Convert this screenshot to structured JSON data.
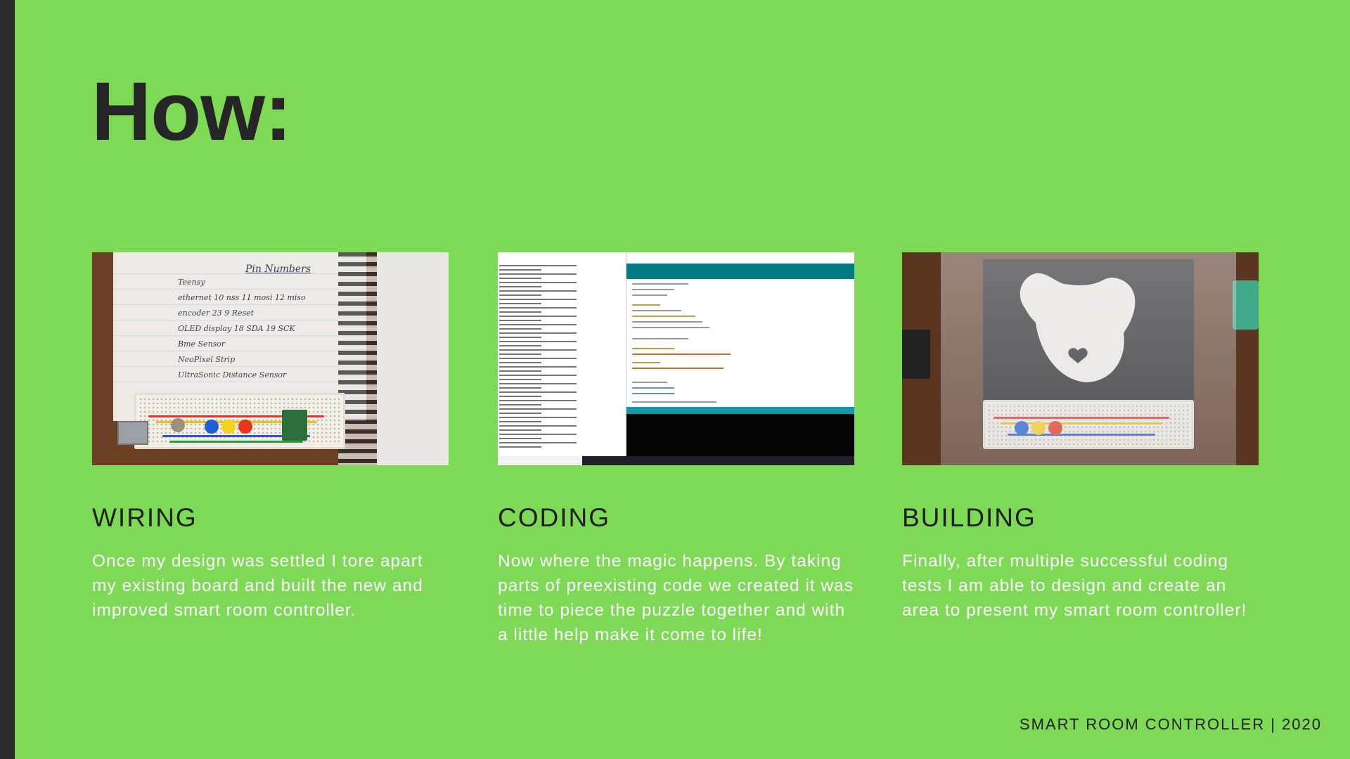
{
  "slide": {
    "title": "How:",
    "footer": "SMART ROOM CONTROLLER | 2020"
  },
  "colors": {
    "background": "#7ed957",
    "accent_bar": "#2b2b2b",
    "heading": "#262626",
    "body_text": "#ffffff"
  },
  "cards": [
    {
      "heading": "WIRING",
      "text": "Once my design was settled I tore apart my existing board and built the new and improved smart room controller.",
      "image": "wiring-photo",
      "notes": {
        "title": "Pin Numbers",
        "rows": [
          "Teensy",
          "ethernet   10 nss   11 mosi   12 miso",
          "encoder    23   9 Reset",
          "OLED display   18 SDA   19 SCK",
          "Bme Sensor",
          "NeoPixel Strip",
          "UltraSonic Distance Sensor"
        ]
      }
    },
    {
      "heading": "CODING",
      "text": "Now where the magic happens. By taking parts of preexisting code we created it was time to piece the puzzle together and with a little help make it come to life!",
      "image": "coding-screenshot"
    },
    {
      "heading": "BUILDING",
      "text": "Finally, after multiple successful coding tests I am able to design and create an area to present my smart room controller!",
      "image": "building-photo"
    }
  ]
}
